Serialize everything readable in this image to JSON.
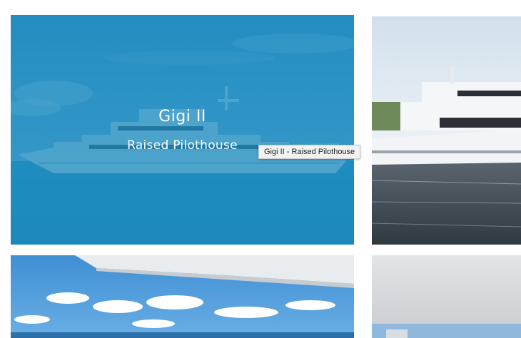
{
  "gallery": {
    "items": [
      {
        "title": "Gigi II",
        "subtitle": "Raised Pilothouse",
        "tooltip": "Gigi II - Raised Pilothouse",
        "hovered": true
      },
      {
        "image": "white-yacht-at-dock"
      },
      {
        "image": "sky-view-from-deck"
      },
      {
        "image": "deck-ceiling-view"
      }
    ]
  },
  "colors": {
    "overlay": "#1c8cbe",
    "sky": "#5aaee0",
    "water": "#3a8fc8"
  }
}
